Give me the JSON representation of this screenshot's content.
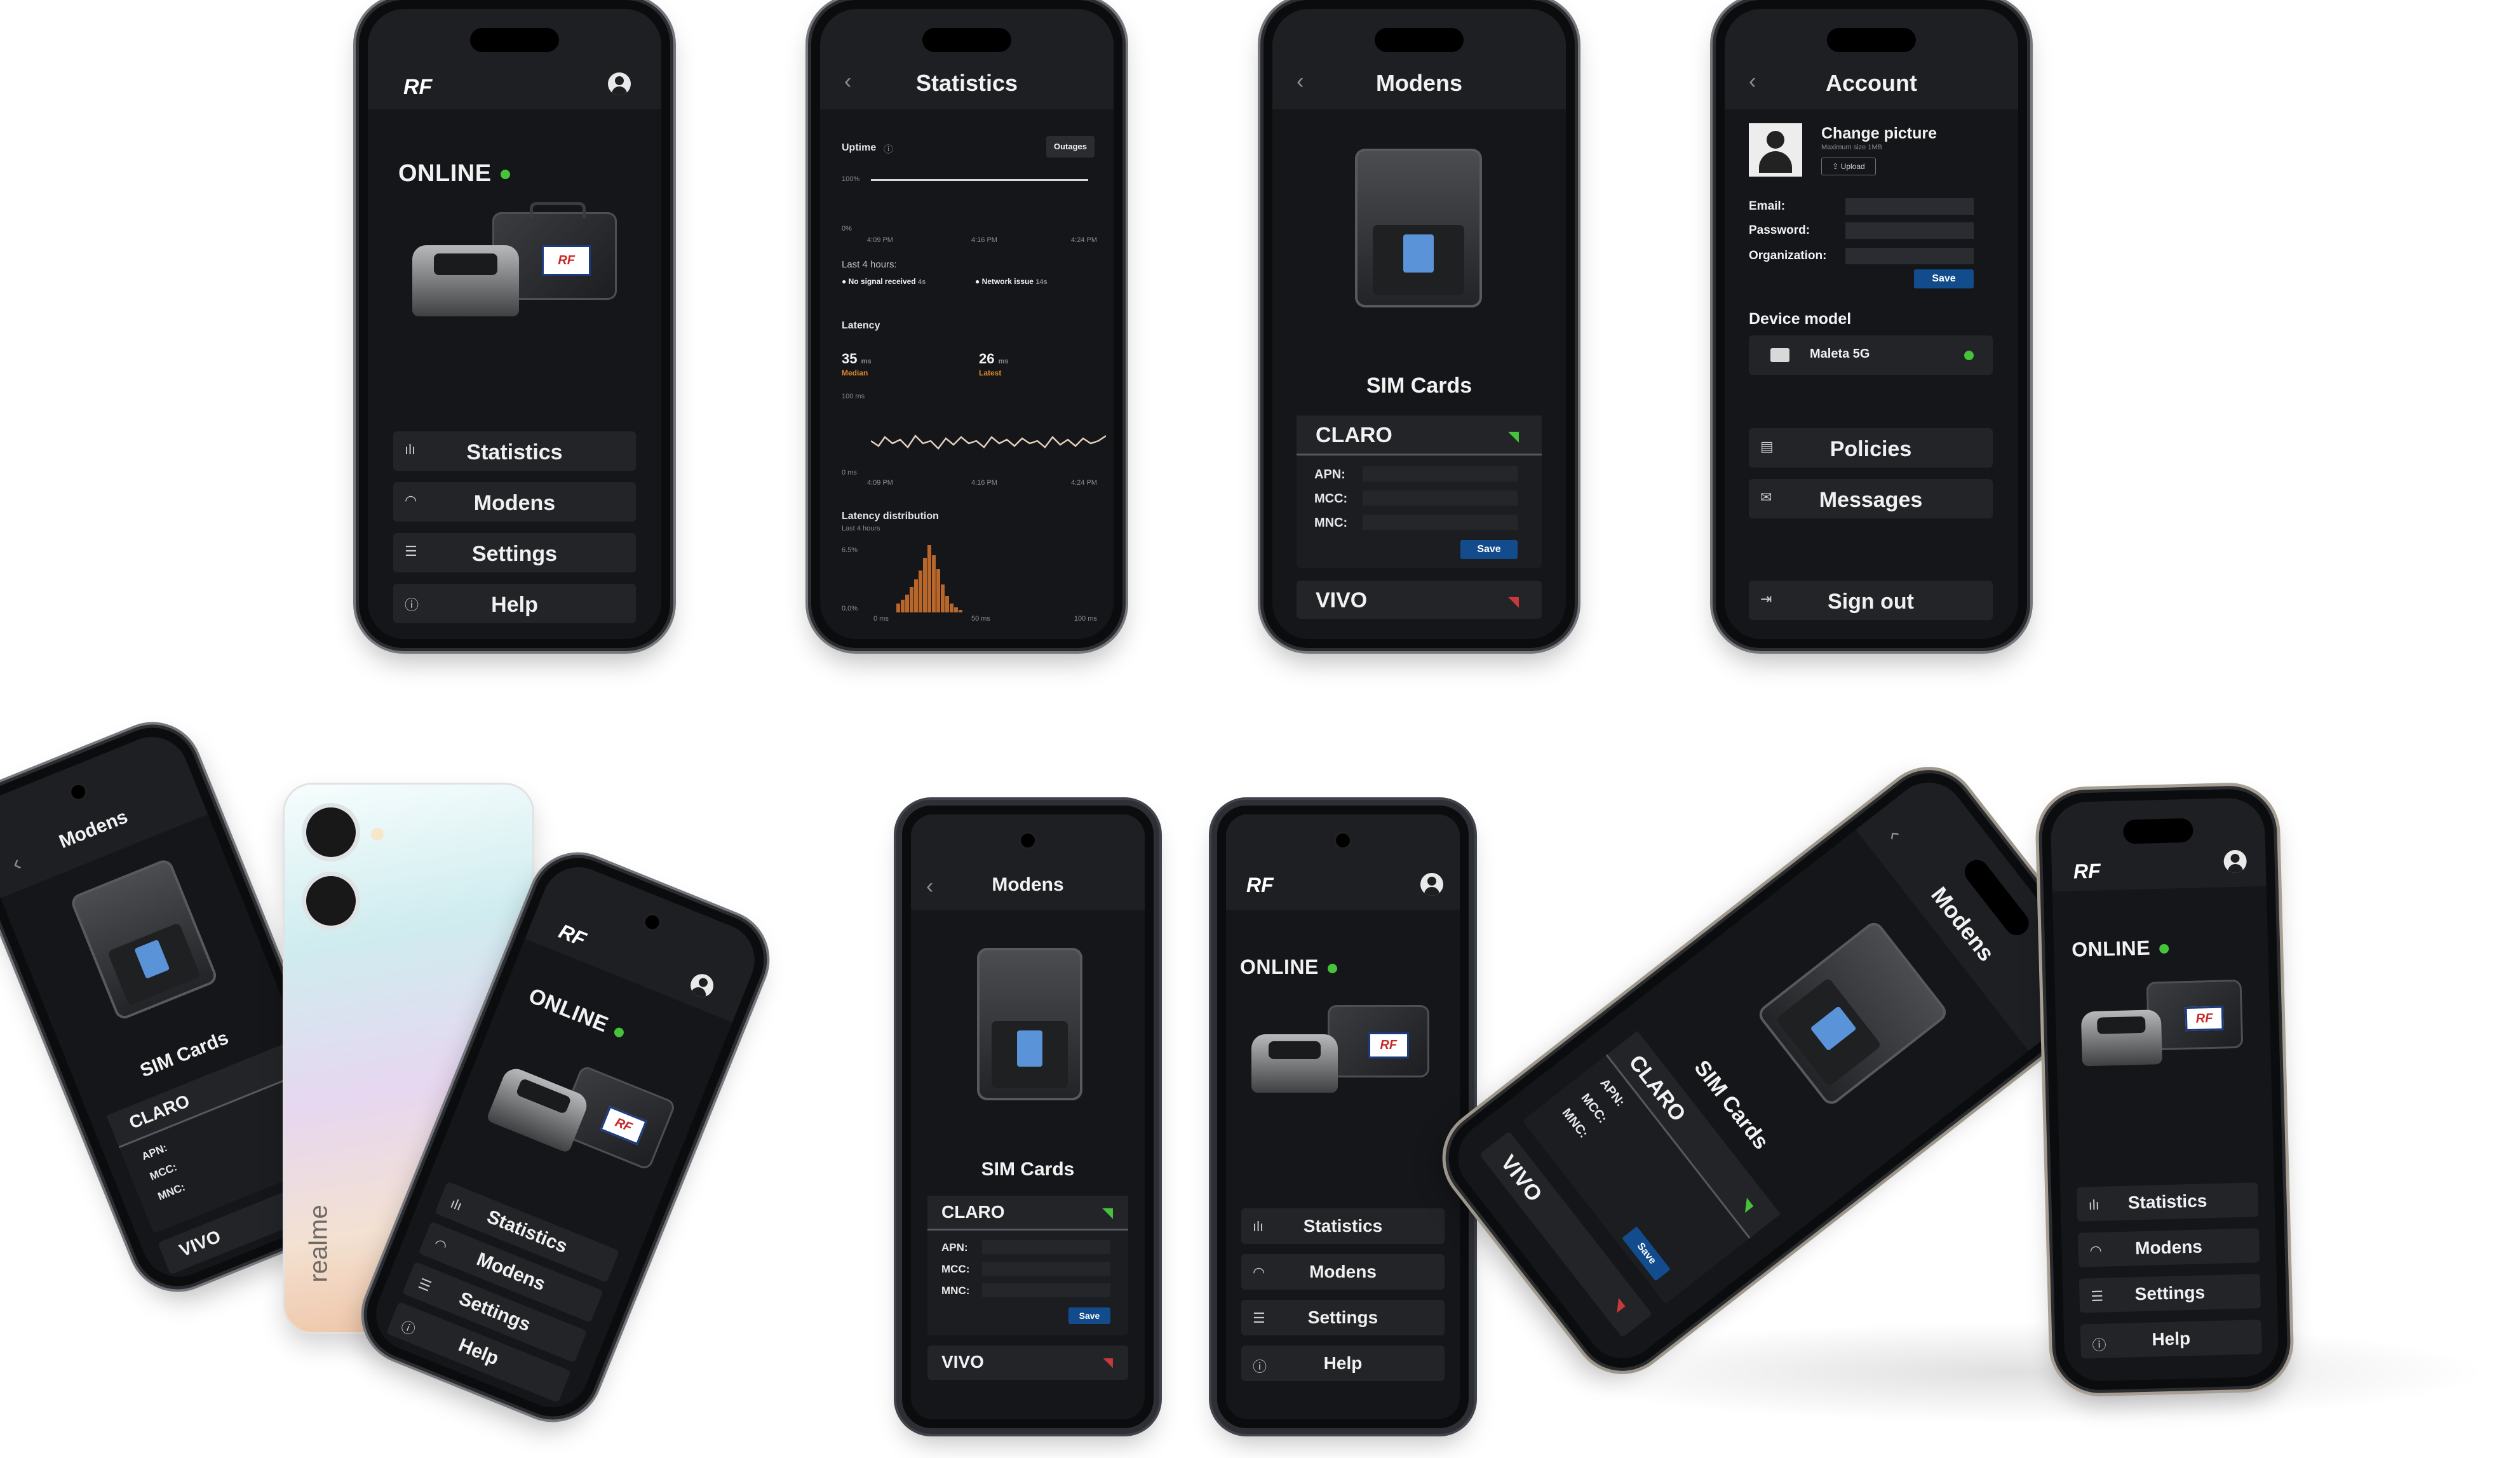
{
  "brand": {
    "logo_text": "RF"
  },
  "home": {
    "status": "ONLINE",
    "status_color": "#46c33a",
    "menu": [
      {
        "label": "Statistics",
        "icon": "bar-chart-icon"
      },
      {
        "label": "Modens",
        "icon": "wifi-icon"
      },
      {
        "label": "Settings",
        "icon": "sliders-icon"
      },
      {
        "label": "Help",
        "icon": "info-icon"
      }
    ]
  },
  "statistics": {
    "title": "Statistics",
    "uptime_label": "Uptime",
    "outages_button": "Outages",
    "uptime_y_top": "100%",
    "uptime_y_bottom": "0%",
    "time_ticks": [
      "4:09 PM",
      "4:16 PM",
      "4:24 PM"
    ],
    "last_hours_label": "Last 4 hours:",
    "legend_no_signal": "No signal received",
    "legend_no_signal_value": "4s",
    "legend_network": "Network issue",
    "legend_network_value": "14s",
    "latency_label": "Latency",
    "median_value": "35",
    "median_unit": "ms",
    "median_label": "Median",
    "latest_value": "26",
    "latest_unit": "ms",
    "latest_label": "Latest",
    "latency_y_top": "100 ms",
    "latency_y_bottom": "0 ms",
    "distribution_label": "Latency distribution",
    "distribution_sub": "Last 4 hours",
    "dist_y_top": "6.5%",
    "dist_y_bottom": "0.0%",
    "dist_x": [
      "0 ms",
      "50 ms",
      "100 ms"
    ],
    "accent": "#e08a2c"
  },
  "modens": {
    "title": "Modens",
    "sim_title": "SIM Cards",
    "sims": [
      {
        "name": "CLARO",
        "signal_color": "#46c33a"
      },
      {
        "name": "VIVO",
        "signal_color": "#c83a3a"
      }
    ],
    "fields": [
      "APN:",
      "MCC:",
      "MNC:"
    ],
    "save_label": "Save"
  },
  "account": {
    "title": "Account",
    "change_picture": "Change picture",
    "max_size": "Maximum size 1MB",
    "upload_label": "Upload",
    "email_label": "Email:",
    "password_label": "Password:",
    "organization_label": "Organization:",
    "save_label": "Save",
    "device_model_label": "Device model",
    "device_name": "Maleta 5G",
    "menu": [
      {
        "label": "Policies",
        "icon": "document-icon"
      },
      {
        "label": "Messages",
        "icon": "envelope-icon"
      }
    ],
    "sign_out": "Sign out"
  },
  "realme": {
    "brand_text": "realme"
  }
}
